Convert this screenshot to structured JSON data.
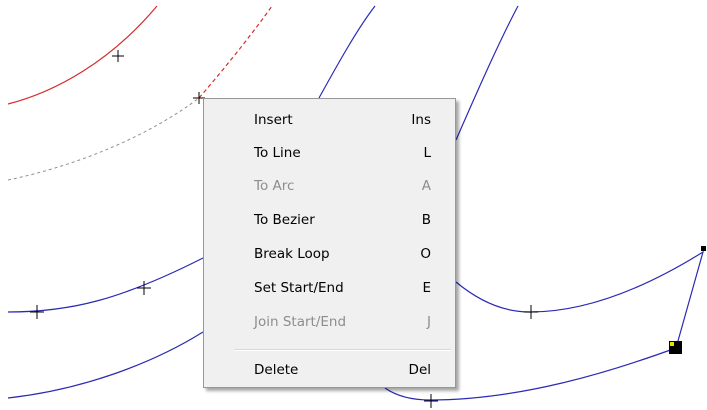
{
  "colors": {
    "canvas_bg": "#ffffff",
    "path_blue": "#2a2ab4",
    "path_red": "#d52b2b",
    "path_gray_dashed": "#909090",
    "handle_black": "#000000",
    "handle_yellow": "#e8e000",
    "menu_bg": "#f0f0f0",
    "menu_disabled_text": "#8d8d8d"
  },
  "context_menu": {
    "items": [
      {
        "label": "Insert",
        "shortcut": "Ins",
        "enabled": true
      },
      {
        "label": "To Line",
        "shortcut": "L",
        "enabled": true
      },
      {
        "label": "To Arc",
        "shortcut": "A",
        "enabled": false
      },
      {
        "label": "To Bezier",
        "shortcut": "B",
        "enabled": true
      },
      {
        "label": "Break Loop",
        "shortcut": "O",
        "enabled": true
      },
      {
        "label": "Set Start/End",
        "shortcut": "E",
        "enabled": true
      },
      {
        "label": "Join Start/End",
        "shortcut": "J",
        "enabled": false
      },
      {
        "label": "Delete",
        "shortcut": "Del",
        "enabled": true
      }
    ]
  }
}
